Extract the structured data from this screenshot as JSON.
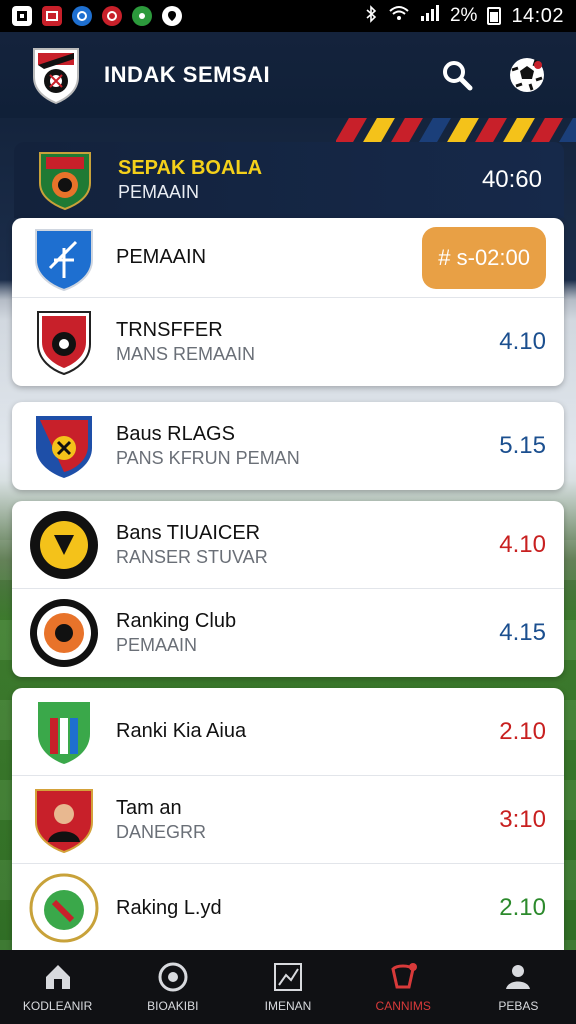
{
  "status_bar": {
    "battery": "2%",
    "time": "14:02",
    "app_icons": [
      "square-app-icon",
      "red-app-icon",
      "blue-app-icon",
      "red-circle-app-icon",
      "green-app-icon",
      "location-icon"
    ]
  },
  "header": {
    "title": "INDAK SEMSAI",
    "actions": [
      "search-icon",
      "soccer-ball-icon"
    ]
  },
  "featured": {
    "title": "SEPAK BOALA",
    "subtitle": "PEMAAIN",
    "time": "40:60"
  },
  "cards": [
    {
      "rows": [
        {
          "title": "PEMAAIN",
          "subtitle": "",
          "value": "# s-02:00",
          "style": "pill",
          "badge": "blue-shield"
        },
        {
          "title": "TRNSFFER",
          "subtitle": "MANS REMAAIN",
          "value": "4.10",
          "style": "blue",
          "badge": "red-shield"
        }
      ]
    },
    {
      "rows": [
        {
          "title": "Baus RLAGS",
          "subtitle": "PANS KFRUN PEMAN",
          "value": "5.15",
          "style": "blue",
          "badge": "red-blue-shield"
        }
      ]
    },
    {
      "rows": [
        {
          "title": "Bans TIUAICER",
          "subtitle": "RANSER STUVAR",
          "value": "4.10",
          "style": "red",
          "badge": "yellow-round"
        },
        {
          "title": "Ranking Club",
          "subtitle": "PEMAAIN",
          "value": "4.15",
          "style": "blue",
          "badge": "orange-round"
        }
      ]
    },
    {
      "rows": [
        {
          "title": "Ranki Kia Aiua",
          "subtitle": "",
          "value": "2.10",
          "style": "red",
          "badge": "green-shield"
        },
        {
          "title": "Tam an",
          "subtitle": "DANEGRR",
          "value": "3:10",
          "style": "red",
          "badge": "player-shield"
        },
        {
          "title": "Raking L.yd",
          "subtitle": "",
          "value": "2.10",
          "style": "green",
          "badge": "green-round"
        }
      ]
    }
  ],
  "bottom_nav": [
    {
      "label": "KODLEANIR",
      "icon": "home-icon",
      "active": false
    },
    {
      "label": "BIOAKIBI",
      "icon": "ball-icon",
      "active": false
    },
    {
      "label": "IMENAN",
      "icon": "chart-icon",
      "active": false
    },
    {
      "label": "CANNIMS",
      "icon": "trophy-icon",
      "active": true
    },
    {
      "label": "PEBAS",
      "icon": "team-icon",
      "active": false
    }
  ],
  "colors": {
    "accent_yellow": "#f4d01a",
    "pill_orange": "#e8a045",
    "value_blue": "#1b4f8f",
    "value_red": "#c82020",
    "value_green": "#2c8a2c",
    "nav_active": "#d83a3a"
  }
}
